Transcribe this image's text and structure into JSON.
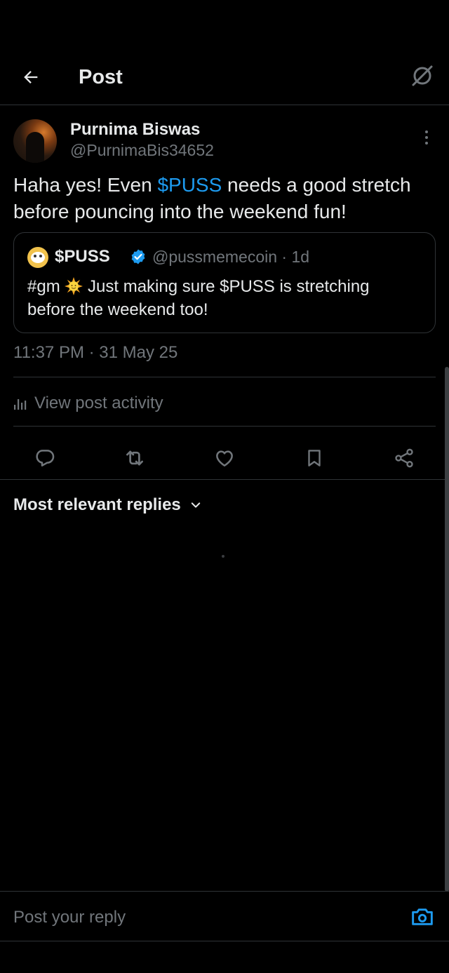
{
  "header": {
    "title": "Post"
  },
  "post": {
    "author_name": "Purnima Biswas",
    "author_handle": "@PurnimaBis34652",
    "text_before": "Haha yes! Even ",
    "cashtag": "$PUSS",
    "text_after": " needs a good stretch before pouncing into the weekend fun!",
    "timestamp": "11:37 PM · 31 May 25",
    "activity_label": "View post activity"
  },
  "quote": {
    "name": "$PUSS",
    "handle_time": "@pussmemecoin · 1d",
    "text_before": "#gm ",
    "text_after": " Just making sure $PUSS is stretching before the weekend too!"
  },
  "replies": {
    "sort_label": "Most relevant replies"
  },
  "reply_bar": {
    "placeholder": "Post your reply"
  },
  "colors": {
    "background": "#000000",
    "accent": "#1d9bf0",
    "text_primary": "#e7e9ea",
    "text_secondary": "#71767b",
    "border": "#2f3336"
  },
  "icons": {
    "back": "arrow-left-icon",
    "grok": "grok-icon",
    "more": "more-vertical-icon",
    "verified": "verified-badge-icon",
    "sun": "sun-emoji-icon",
    "analytics": "analytics-icon",
    "reply": "reply-icon",
    "repost": "repost-icon",
    "like": "heart-icon",
    "bookmark": "bookmark-icon",
    "share": "share-icon",
    "chevron": "chevron-down-icon",
    "camera": "camera-icon"
  }
}
